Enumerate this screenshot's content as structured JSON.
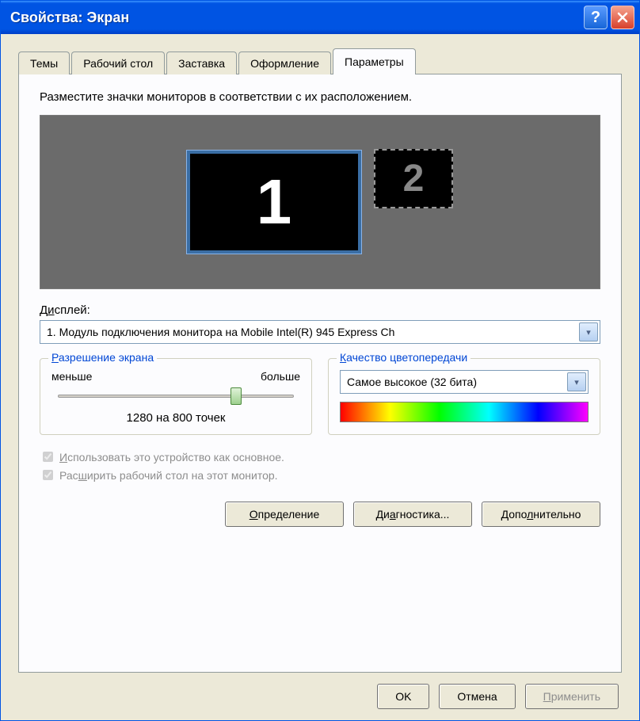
{
  "window": {
    "title": "Свойства: Экран"
  },
  "tabs": [
    {
      "label": "Темы"
    },
    {
      "label": "Рабочий стол"
    },
    {
      "label": "Заставка"
    },
    {
      "label": "Оформление"
    },
    {
      "label": "Параметры"
    }
  ],
  "instruction": "Разместите значки мониторов в соответствии с их расположением.",
  "monitors": {
    "primary": "1",
    "secondary": "2"
  },
  "display": {
    "label_prefix": "Д",
    "label_ul": "и",
    "label_suffix": "сплей:",
    "value": "1. Модуль подключения монитора на Mobile Intel(R) 945 Express Ch"
  },
  "resolution": {
    "legend_prefix": "",
    "legend_ul": "Р",
    "legend_suffix": "азрешение экрана",
    "less": "меньше",
    "more": "больше",
    "value": "1280 на 800 точек"
  },
  "quality": {
    "legend_prefix": "",
    "legend_ul": "К",
    "legend_suffix": "ачество цветопередачи",
    "value": "Самое высокое (32 бита)"
  },
  "checks": {
    "primary_prefix": "",
    "primary_ul": "И",
    "primary_suffix": "спользовать это устройство как основное.",
    "extend_prefix": "Рас",
    "extend_ul": "ш",
    "extend_suffix": "ирить рабочий стол на этот монитор."
  },
  "buttons": {
    "identify_prefix": "",
    "identify_ul": "О",
    "identify_suffix": "пределение",
    "troubleshoot_prefix": "Ди",
    "troubleshoot_ul": "а",
    "troubleshoot_suffix": "гностика...",
    "advanced_prefix": "Допо",
    "advanced_ul": "л",
    "advanced_suffix": "нительно"
  },
  "dialog": {
    "ok": "OK",
    "cancel": "Отмена",
    "apply_prefix": "",
    "apply_ul": "П",
    "apply_suffix": "рименить"
  }
}
